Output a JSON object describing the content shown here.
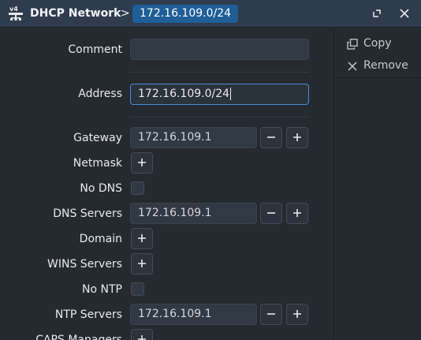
{
  "titlebar": {
    "title": "DHCP Network",
    "separator": ">",
    "current": "172.16.109.0/24"
  },
  "side_actions": {
    "copy_label": "Copy",
    "remove_label": "Remove"
  },
  "form": {
    "comment": {
      "label": "Comment",
      "value": ""
    },
    "address": {
      "label": "Address",
      "value": "172.16.109.0/24"
    },
    "gateway": {
      "label": "Gateway",
      "value": "172.16.109.1"
    },
    "netmask": {
      "label": "Netmask"
    },
    "no_dns": {
      "label": "No DNS",
      "checked": false
    },
    "dns_servers": {
      "label": "DNS Servers",
      "value": "172.16.109.1"
    },
    "domain": {
      "label": "Domain"
    },
    "wins_servers": {
      "label": "WINS Servers"
    },
    "no_ntp": {
      "label": "No NTP",
      "checked": false
    },
    "ntp_servers": {
      "label": "NTP Servers",
      "value": "172.16.109.1"
    },
    "caps_managers": {
      "label": "CAPS Managers"
    }
  },
  "colors": {
    "titlebar_bg": "#2f3c4d",
    "pill_bg": "#1f5e97",
    "window_bg": "#252a31",
    "field_bg": "#313944",
    "focus_border": "#4a8ed6"
  }
}
